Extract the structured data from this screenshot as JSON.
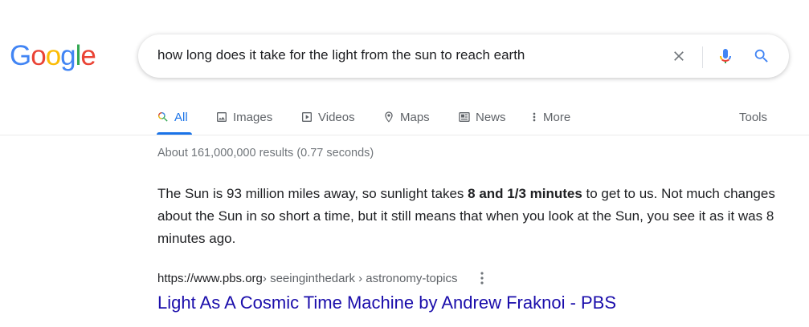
{
  "logo": {
    "letters": [
      "G",
      "o",
      "o",
      "g",
      "l",
      "e"
    ],
    "colors": [
      "#4285f4",
      "#ea4335",
      "#fbbc05",
      "#4285f4",
      "#34a853",
      "#ea4335"
    ]
  },
  "search": {
    "query": "how long does it take for the light from the sun to reach earth"
  },
  "icons": {
    "clear": "close-icon",
    "mic": "microphone-icon",
    "search": "search-icon"
  },
  "tabs": [
    {
      "label": "All",
      "icon": "search-icon",
      "active": true
    },
    {
      "label": "Images",
      "icon": "image-icon"
    },
    {
      "label": "Videos",
      "icon": "video-icon"
    },
    {
      "label": "Maps",
      "icon": "map-pin-icon"
    },
    {
      "label": "News",
      "icon": "news-icon"
    },
    {
      "label": "More",
      "icon": "more-vert-icon"
    }
  ],
  "tools_label": "Tools",
  "result_stats": "About 161,000,000 results (0.77 seconds)",
  "featured_snippet": {
    "text_before": "The Sun is 93 million miles away, so sunlight takes ",
    "bold": "8 and 1/3 minutes",
    "text_after": " to get to us. Not much changes about the Sun in so short a time, but it still means that when you look at the Sun, you see it as it was 8 minutes ago."
  },
  "result": {
    "domain": "https://www.pbs.org",
    "path": " › seeinginthedark › astronomy-topics",
    "title": "Light As A Cosmic Time Machine by Andrew Fraknoi - PBS"
  },
  "colors": {
    "accent": "#1a73e8",
    "link": "#1a0dab",
    "muted": "#70757a"
  }
}
